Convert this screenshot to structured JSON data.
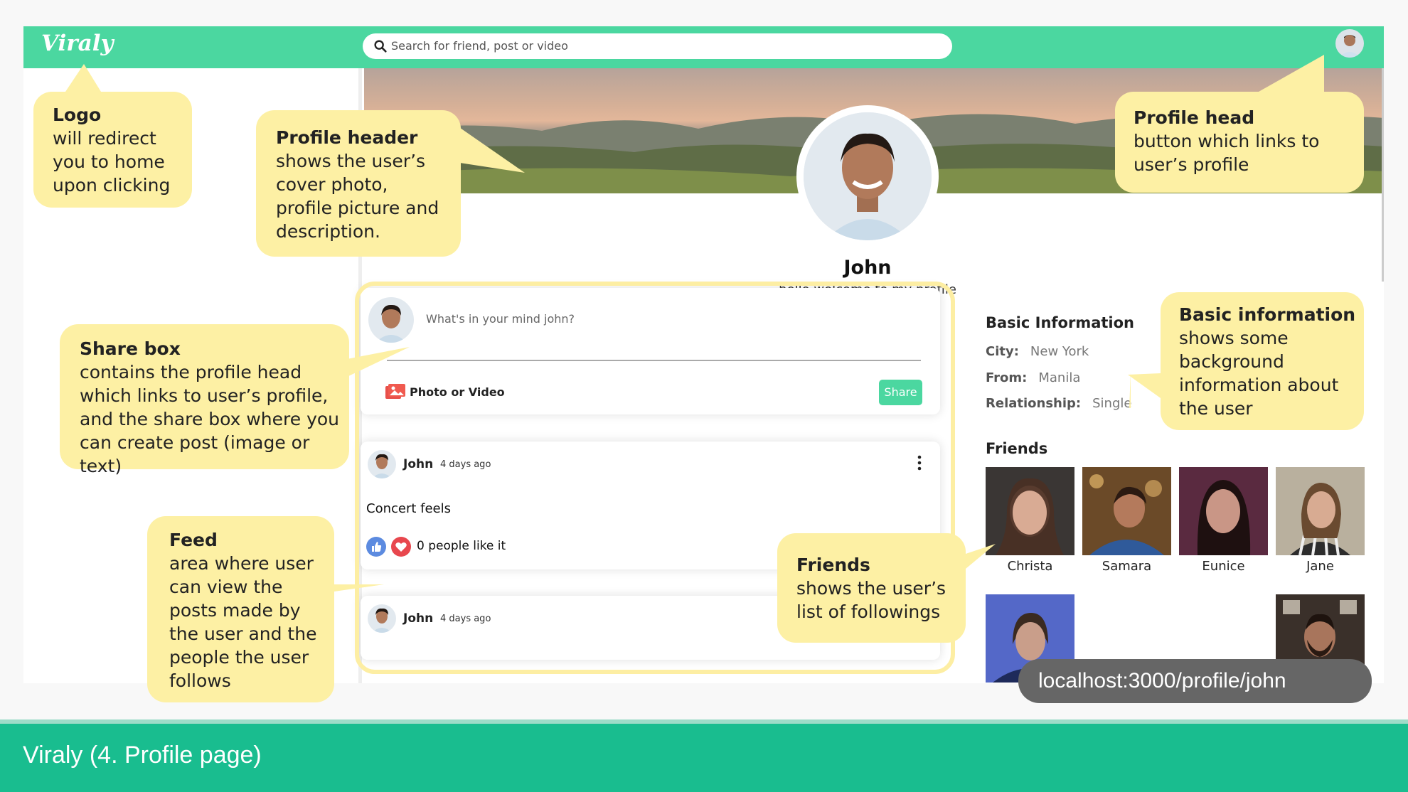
{
  "app": {
    "logo": "Viraly",
    "search_placeholder": "Search for friend, post or video"
  },
  "profile": {
    "name": "John",
    "description": "hello welcome to my profile"
  },
  "sharebox": {
    "placeholder": "What's in your mind john?",
    "photo_option": "Photo or Video",
    "share_button": "Share"
  },
  "posts": [
    {
      "user": "John",
      "time": "4 days ago",
      "text": "Concert feels",
      "likes": "0 people like it"
    },
    {
      "user": "John",
      "time": "4 days ago"
    }
  ],
  "info": {
    "title": "Basic Information",
    "rows": [
      {
        "key": "City:",
        "value": "New York"
      },
      {
        "key": "From:",
        "value": "Manila"
      },
      {
        "key": "Relationship:",
        "value": "Single"
      }
    ]
  },
  "friends": {
    "title": "Friends",
    "names": [
      "Christa",
      "Samara",
      "Eunice",
      "Jane"
    ]
  },
  "callouts": {
    "logo": {
      "title": "Logo",
      "text": "will redirect you to home upon clicking"
    },
    "profile_header": {
      "title": "Profile header",
      "text": "shows the user’s cover photo, profile picture and description."
    },
    "profile_head": {
      "title": "Profile head",
      "text": "button which links to user’s profile"
    },
    "share_box": {
      "title": "Share box",
      "text": "contains the profile head which links to user’s profile, and the share box where you can create post (image or text)"
    },
    "feed": {
      "title": "Feed",
      "text": "area where user can view the posts made by the user and the people the user follows"
    },
    "friends": {
      "title": "Friends",
      "text": "shows the user’s list of followings"
    },
    "basic_info": {
      "title": "Basic information",
      "text": "shows some background information about the user"
    }
  },
  "url": "localhost:3000/profile/john",
  "slide_title": "Viraly (4. Profile page)",
  "colors": {
    "accent": "#4bd7a0",
    "bottom_bar": "#19bd8f",
    "callout": "#fdf0a4"
  }
}
